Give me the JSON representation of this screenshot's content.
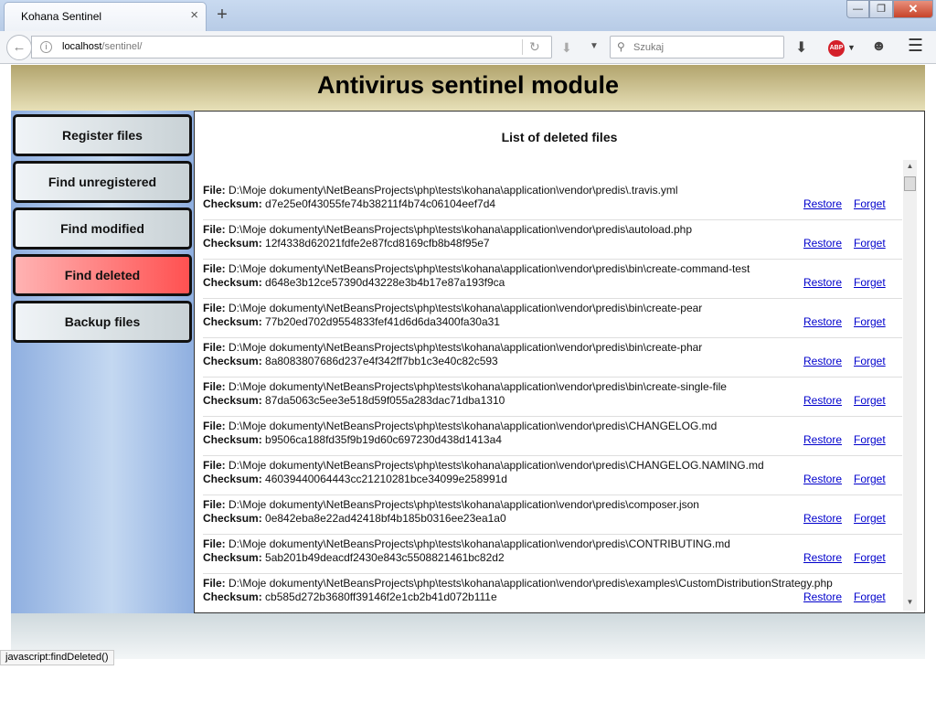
{
  "browser": {
    "tab_title": "Kohana Sentinel",
    "tab_close": "×",
    "new_tab": "+",
    "win_min": "—",
    "win_max": "❐",
    "win_close": "✕",
    "url_host": "localhost",
    "url_path": "/sentinel/",
    "search_placeholder": "Szukaj",
    "abp_label": "ABP"
  },
  "header": {
    "title": "Antivirus sentinel module"
  },
  "sidebar": {
    "items": [
      {
        "label": "Register files",
        "active": false
      },
      {
        "label": "Find unregistered",
        "active": false
      },
      {
        "label": "Find modified",
        "active": false
      },
      {
        "label": "Find deleted",
        "active": true
      },
      {
        "label": "Backup files",
        "active": false
      }
    ]
  },
  "content": {
    "title": "List of deleted files",
    "file_label": "File:",
    "checksum_label": "Checksum:",
    "restore_label": "Restore",
    "forget_label": "Forget",
    "files": [
      {
        "path": "D:\\Moje dokumenty\\NetBeansProjects\\php\\tests\\kohana\\application\\vendor\\predis\\.travis.yml",
        "checksum": "d7e25e0f43055fe74b38211f4b74c06104eef7d4"
      },
      {
        "path": "D:\\Moje dokumenty\\NetBeansProjects\\php\\tests\\kohana\\application\\vendor\\predis\\autoload.php",
        "checksum": "12f4338d62021fdfe2e87fcd8169cfb8b48f95e7"
      },
      {
        "path": "D:\\Moje dokumenty\\NetBeansProjects\\php\\tests\\kohana\\application\\vendor\\predis\\bin\\create-command-test",
        "checksum": "d648e3b12ce57390d43228e3b4b17e87a193f9ca"
      },
      {
        "path": "D:\\Moje dokumenty\\NetBeansProjects\\php\\tests\\kohana\\application\\vendor\\predis\\bin\\create-pear",
        "checksum": "77b20ed702d9554833fef41d6d6da3400fa30a31"
      },
      {
        "path": "D:\\Moje dokumenty\\NetBeansProjects\\php\\tests\\kohana\\application\\vendor\\predis\\bin\\create-phar",
        "checksum": "8a8083807686d237e4f342ff7bb1c3e40c82c593"
      },
      {
        "path": "D:\\Moje dokumenty\\NetBeansProjects\\php\\tests\\kohana\\application\\vendor\\predis\\bin\\create-single-file",
        "checksum": "87da5063c5ee3e518d59f055a283dac71dba1310"
      },
      {
        "path": "D:\\Moje dokumenty\\NetBeansProjects\\php\\tests\\kohana\\application\\vendor\\predis\\CHANGELOG.md",
        "checksum": "b9506ca188fd35f9b19d60c697230d438d1413a4"
      },
      {
        "path": "D:\\Moje dokumenty\\NetBeansProjects\\php\\tests\\kohana\\application\\vendor\\predis\\CHANGELOG.NAMING.md",
        "checksum": "46039440064443cc21210281bce34099e258991d"
      },
      {
        "path": "D:\\Moje dokumenty\\NetBeansProjects\\php\\tests\\kohana\\application\\vendor\\predis\\composer.json",
        "checksum": "0e842eba8e22ad42418bf4b185b0316ee23ea1a0"
      },
      {
        "path": "D:\\Moje dokumenty\\NetBeansProjects\\php\\tests\\kohana\\application\\vendor\\predis\\CONTRIBUTING.md",
        "checksum": "5ab201b49deacdf2430e843c5508821461bc82d2"
      },
      {
        "path": "D:\\Moje dokumenty\\NetBeansProjects\\php\\tests\\kohana\\application\\vendor\\predis\\examples\\CustomDistributionStrategy.php",
        "checksum": "cb585d272b3680ff39146f2e1cb2b41d072b111e"
      }
    ]
  },
  "status_text": "javascript:findDeleted()",
  "colors": {
    "header_gradient": [
      "#b2a46d",
      "#e7e0b8"
    ],
    "sidebar_blue": "#8fafe0",
    "active_button": "#ff5151",
    "link": "#0000cc"
  },
  "icons": [
    "back-arrow-icon",
    "info-icon",
    "reload-icon",
    "pocket-icon",
    "search-icon",
    "download-icon",
    "adblock-icon",
    "smiley-icon",
    "hamburger-menu-icon"
  ]
}
